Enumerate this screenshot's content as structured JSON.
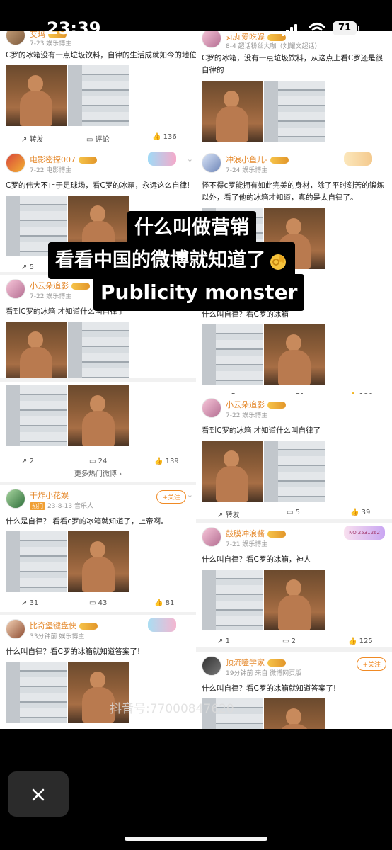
{
  "status": {
    "time": "23:39",
    "battery": "71"
  },
  "left": {
    "p1": {
      "name": "艾玛",
      "meta": "7-23  娱乐博主",
      "text": "C罗的冰箱没有一点垃圾饮料，自律的生活成就如今的地位",
      "repost": "转发",
      "comment": "评论",
      "likes": "136"
    },
    "p2": {
      "name": "电影密探007",
      "meta": "7-22  电影博主",
      "text": "C罗的伟大不止于足球场，看C罗的冰箱，永远这么自律!",
      "repost": "5"
    },
    "p3": {
      "name": "小云朵追影",
      "meta": "7-22  娱乐博主",
      "text": "看到C罗的冰箱 才知道什么叫自律了"
    },
    "p4": {
      "repost": "2",
      "comment": "24",
      "likes": "139",
      "more": "更多热门微博 ›"
    },
    "p5": {
      "name": "干炸小花娱",
      "tag": "热门",
      "meta": "23-8-13  音乐人",
      "follow": "+关注",
      "text": "什么是自律？ 看看c罗的冰箱就知道了，上帝啊。",
      "repost": "31",
      "comment": "43",
      "likes": "81"
    },
    "p6": {
      "name": "比奇堡键盘侠",
      "meta": "33分钟前  娱乐博主",
      "text": "什么叫自律？看C罗的冰箱就知道答案了!"
    }
  },
  "right": {
    "p1": {
      "name": "丸丸爱吃娱",
      "meta": "8-4  超话粉丝大咖（刘耀文超话）",
      "text": "C罗的冰箱，没有一点垃圾饮料，从这点上看C罗还是很自律的"
    },
    "p2": {
      "name": "冲浪小鱼儿-",
      "meta": "7-24  娱乐博主",
      "text": "怪不得c罗能拥有如此完美的身材，除了平时刻苦的锻炼以外，看了他的冰箱才知道，真的是太自律了。"
    },
    "p3": {
      "text": "什么叫自律？看C罗的冰箱",
      "repost": "5",
      "comment": "71",
      "likes": "186"
    },
    "p4": {
      "name": "小云朵追影",
      "meta": "7-22  娱乐博主",
      "text": "看到C罗的冰箱 才知道什么叫自律了",
      "repost": "转发",
      "comment": "5",
      "likes": "39"
    },
    "p5": {
      "name": "鼓膜冲浪酱",
      "meta": "7-21  娱乐博主",
      "badge": "NO.2531262",
      "text": "什么叫自律？看C罗的冰箱，神人",
      "repost": "1",
      "comment": "2",
      "likes": "125"
    },
    "p6": {
      "name": "顶流嗑学家",
      "meta": "19分钟前  来自 微博网页版",
      "follow": "+关注",
      "text": "什么叫自律？看C罗的冰箱就知道答案了!"
    }
  },
  "overlay": {
    "line1": "什么叫做营销",
    "line2": "看看中国的微博就知道了",
    "line3": "Publicity monster",
    "emoji_icon": "ok-hand-icon",
    "watermark": "抖音号:77000847620"
  },
  "colors": {
    "accent": "#f08a24",
    "caption_bg": "#000000",
    "text_on_caption": "#ffffff"
  }
}
